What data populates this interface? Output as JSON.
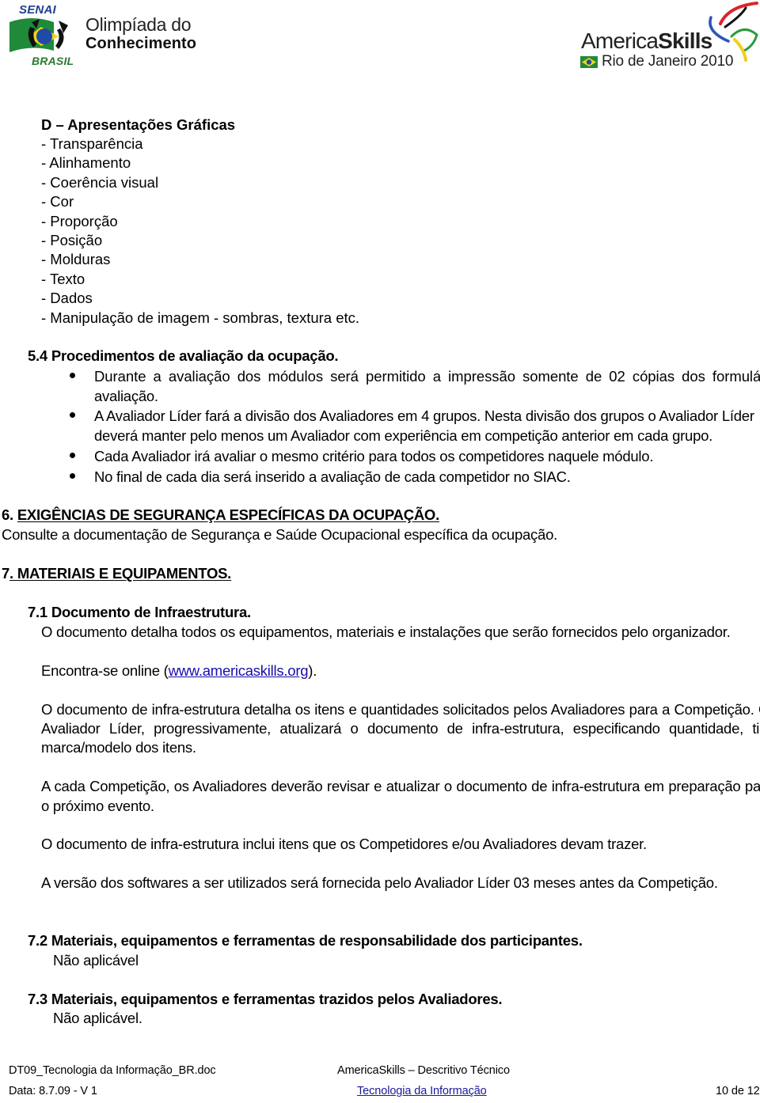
{
  "header": {
    "left_logo": {
      "top_text": "SENAI",
      "bottom_text": "BRASIL",
      "title_line1": "Olimpíada do",
      "title_line2": "Conhecimento"
    },
    "right_logo": {
      "title_regular": "America",
      "title_bold": "Skills",
      "subtitle": "Rio de Janeiro 2010"
    }
  },
  "section_d": {
    "title": "D – Apresentações Gráficas",
    "items": [
      "- Transparência",
      "- Alinhamento",
      "- Coerência visual",
      "- Cor",
      "- Proporção",
      "- Posição",
      "- Molduras",
      "- Texto",
      "- Dados",
      "- Manipulação de imagem - sombras, textura etc."
    ]
  },
  "section_5_4": {
    "title": "5.4 Procedimentos de avaliação da ocupação.",
    "bullets": [
      {
        "line1": "Durante a avaliação dos módulos será permitido a impressão somente de 02 cópias dos formulários de",
        "line2": "avaliação."
      },
      {
        "line1": "A Avaliador Líder fará a divisão dos Avaliadores em 4 grupos. Nesta divisão dos grupos o Avaliador Líder",
        "line2": "deverá manter pelo menos um Avaliador com experiência em competição anterior em cada grupo."
      },
      {
        "line1": "Cada Avaliador irá avaliar o mesmo critério para todos os competidores naquele módulo."
      },
      {
        "line1": "No final de cada dia será inserido a avaliação de cada competidor no SIAC."
      }
    ]
  },
  "section_6": {
    "number": "6. ",
    "title": "EXIGÊNCIAS DE SEGURANÇA ESPECÍFICAS DA OCUPAÇÃO.",
    "text": "Consulte a documentação de Segurança e Saúde Ocupacional específica da ocupação."
  },
  "section_7": {
    "number": "7",
    "title": ". MATERIAIS E EQUIPAMENTOS.",
    "sub_7_1": {
      "title": "7.1 Documento de Infraestrutura.",
      "p1": "O documento detalha todos os equipamentos, materiais e instalações que serão fornecidos pelo organizador.",
      "p2_prefix": "Encontra-se online (",
      "p2_link": "www.americaskills.org",
      "p2_suffix": ").",
      "p3_line1": "O documento de infra-estrutura detalha os itens e quantidades solicitados pelos Avaliadores para a Competição. O",
      "p3_line2": "Avaliador Líder, progressivamente, atualizará o documento de infra-estrutura, especificando quantidade, tipo e",
      "p3_line3": "marca/modelo dos itens.",
      "p4_line1": "A cada Competição, os Avaliadores deverão revisar e atualizar o documento de infra-estrutura em preparação para",
      "p4_line2": "o próximo evento.",
      "p5": "O documento de infra-estrutura inclui itens que os Competidores e/ou Avaliadores devam trazer.",
      "p6": "A versão dos softwares a ser utilizados será fornecida pelo Avaliador Líder 03 meses antes da Competição."
    },
    "sub_7_2": {
      "title": "7.2 Materiais, equipamentos e ferramentas de responsabilidade dos participantes.",
      "text": "Não aplicável"
    },
    "sub_7_3": {
      "title": "7.3 Materiais, equipamentos e ferramentas trazidos pelos Avaliadores.",
      "text": "Não aplicável."
    }
  },
  "footer": {
    "filename": "DT09_Tecnologia da Informação_BR.doc",
    "doc_title": "AmericaSkills – Descritivo Técnico",
    "date_version": "Data: 8.7.09 - V 1",
    "occupation": "Tecnologia da Informação",
    "page_number": "10 de 12"
  }
}
